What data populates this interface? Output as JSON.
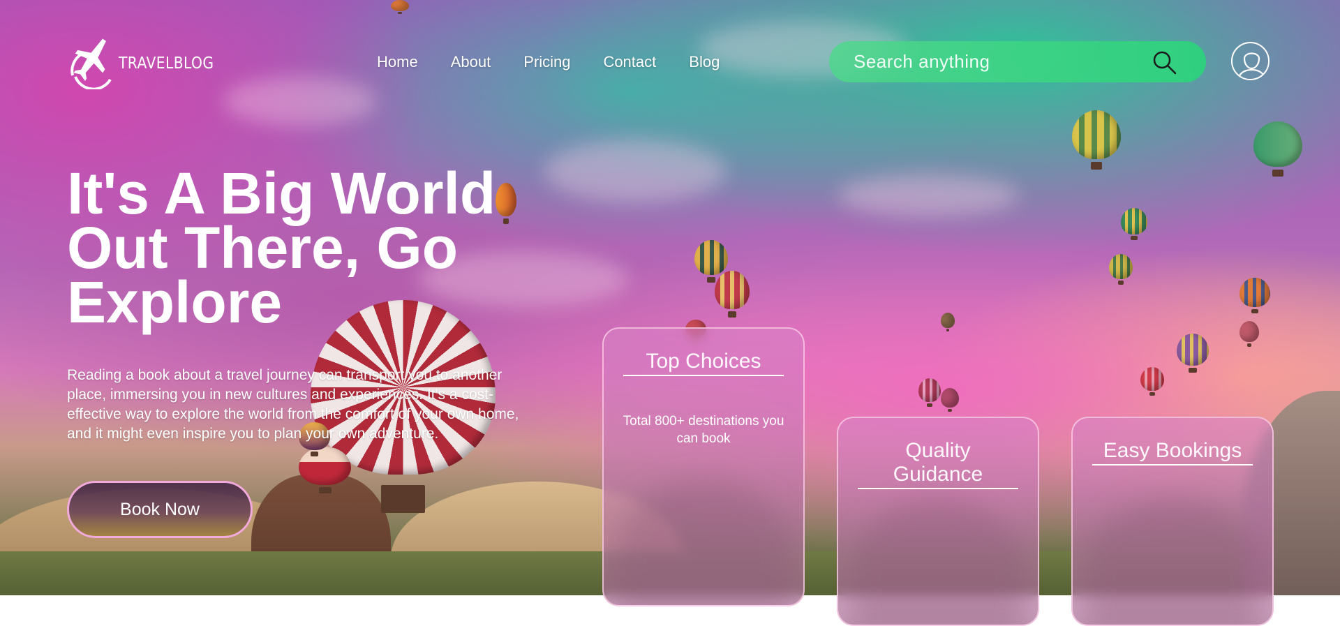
{
  "header": {
    "logo_text": "TRAVELBLOG",
    "nav": [
      "Home",
      "About",
      "Pricing",
      "Contact",
      "Blog"
    ],
    "search_placeholder": "Search anything"
  },
  "hero": {
    "title": "It's A Big World Out There, Go Explore",
    "description": "Reading a book about a travel journey can transport you to another place, immersing you in new cultures and experiences. It's a cost-effective way to explore the world from the comfort of your own home, and it might even inspire you to plan your own adventure.",
    "cta": "Book Now"
  },
  "cards": [
    {
      "title": "Top Choices",
      "text": "Total 800+ destinations you can book"
    },
    {
      "title": "Quality Guidance"
    },
    {
      "title": "Easy Bookings"
    }
  ],
  "icons": {
    "logo": "plane-globe-icon",
    "search": "search-icon",
    "avatar": "user-avatar-icon"
  },
  "colors": {
    "search_bg": "#3dd38a",
    "button_border": "#f2a9dc",
    "card_border": "#ffd2eb"
  }
}
